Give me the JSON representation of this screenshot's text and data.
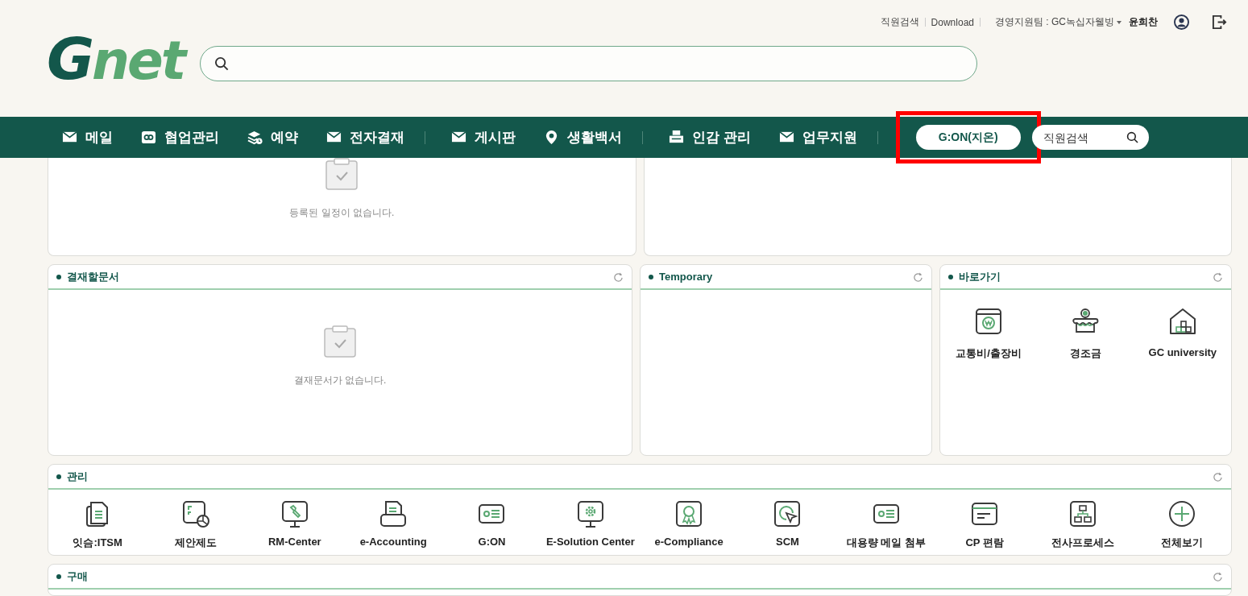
{
  "header": {
    "logo": "Gnet",
    "top_links": [
      {
        "label": "직원검색"
      },
      {
        "label": "Download"
      }
    ],
    "org_selector": "경영지원팀 : GC녹십자웰빙",
    "user_name": "윤희찬"
  },
  "nav": {
    "items": [
      {
        "label": "메일",
        "kind": "mail",
        "divider_after": false
      },
      {
        "label": "협업관리",
        "kind": "link",
        "divider_after": false
      },
      {
        "label": "예약",
        "kind": "stack",
        "divider_after": false
      },
      {
        "label": "전자결재",
        "kind": "mail",
        "divider_after": true
      },
      {
        "label": "게시판",
        "kind": "mail",
        "divider_after": false
      },
      {
        "label": "생활백서",
        "kind": "pin",
        "divider_after": true
      },
      {
        "label": "인감 관리",
        "kind": "printer",
        "divider_after": false
      },
      {
        "label": "업무지원",
        "kind": "mail",
        "divider_after": true
      }
    ],
    "gon_button": {
      "label": "G:ON(지온)",
      "highlighted": true
    },
    "employee_search": {
      "placeholder": "직원검색"
    }
  },
  "top_panels": [
    {
      "kind": "empty",
      "message": "등록된 일정이 없습니다."
    },
    {
      "kind": "blank"
    }
  ],
  "panels": [
    {
      "title": "결재할문서",
      "kind": "empty",
      "message": "결재문서가 없습니다."
    },
    {
      "title": "Temporary",
      "kind": "blank"
    },
    {
      "title": "바로가기",
      "kind": "shortcuts",
      "items": [
        {
          "label": "교통비/출장비",
          "kind": "wallet"
        },
        {
          "label": "경조금",
          "kind": "cake"
        },
        {
          "label": "GC university",
          "kind": "house"
        }
      ]
    }
  ],
  "management": {
    "title": "관리",
    "items": [
      {
        "label": "잇슴:ITSM",
        "kind": "docs"
      },
      {
        "label": "제안제도",
        "kind": "chart"
      },
      {
        "label": "RM-Center",
        "kind": "wrench"
      },
      {
        "label": "e-Accounting",
        "kind": "printer"
      },
      {
        "label": "G:ON",
        "kind": "card"
      },
      {
        "label": "E-Solution Center",
        "kind": "gear"
      },
      {
        "label": "e-Compliance",
        "kind": "award"
      },
      {
        "label": "SCM",
        "kind": "cursor"
      },
      {
        "label": "대용량 메일 첨부",
        "kind": "card"
      },
      {
        "label": "CP 편람",
        "kind": "window"
      },
      {
        "label": "전사프로세스",
        "kind": "org"
      },
      {
        "label": "전체보기",
        "kind": "plus"
      }
    ]
  },
  "purchase": {
    "title": "구매"
  }
}
